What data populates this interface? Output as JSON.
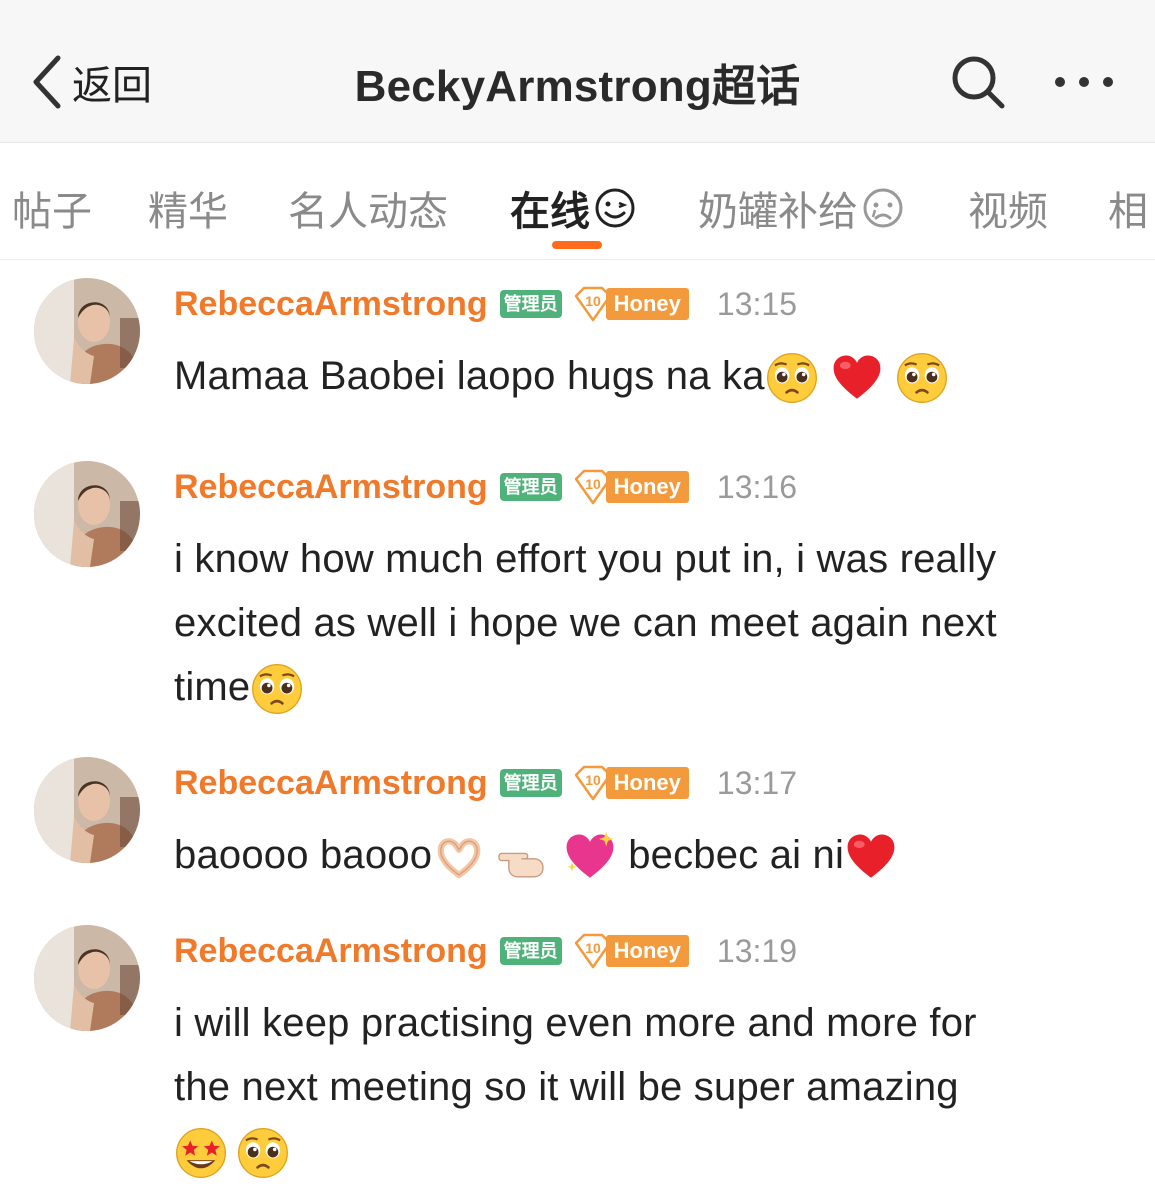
{
  "nav": {
    "back_label": "返回",
    "title": "BeckyArmstrong超话"
  },
  "tabs": [
    {
      "label": "帖子"
    },
    {
      "label": "精华"
    },
    {
      "label": "名人动态"
    },
    {
      "label": "在线",
      "active": true
    },
    {
      "label": "奶罐补给"
    },
    {
      "label": "视频"
    },
    {
      "label": "相"
    }
  ],
  "messages": [
    {
      "username": "RebeccaArmstrong",
      "admin_badge": "管理员",
      "level": "10",
      "level_tag": "Honey",
      "time": "13:15",
      "text": "Mamaa Baobei laopo hugs na ka",
      "emojis": [
        "pleading-face",
        "red-heart",
        "pleading-face"
      ]
    },
    {
      "username": "RebeccaArmstrong",
      "admin_badge": "管理员",
      "level": "10",
      "level_tag": "Honey",
      "time": "13:16",
      "text_lines": [
        "i know how much effort you put in, i was really",
        "excited as well i hope we can meet again next",
        "time"
      ],
      "emojis": [
        "pleading-face"
      ]
    },
    {
      "username": "RebeccaArmstrong",
      "admin_badge": "管理员",
      "level": "10",
      "level_tag": "Honey",
      "time": "13:17",
      "text_part1": "baoooo baooo",
      "text_part2": "becbec ai ni",
      "emojis": [
        "heart-hands",
        "pointing-hand",
        "sparkling-heart",
        "red-heart"
      ]
    },
    {
      "username": "RebeccaArmstrong",
      "admin_badge": "管理员",
      "level": "10",
      "level_tag": "Honey",
      "time": "13:19",
      "text_lines": [
        "i will keep practising even more and more  for",
        "the next meeting so it will be super amazing"
      ],
      "emojis": [
        "star-struck",
        "pleading-face"
      ]
    }
  ],
  "colors": {
    "accent": "#ff6b1a",
    "username": "#f07a2a",
    "admin_badge": "#4fb27a",
    "honey_tag": "#f39a3c"
  }
}
